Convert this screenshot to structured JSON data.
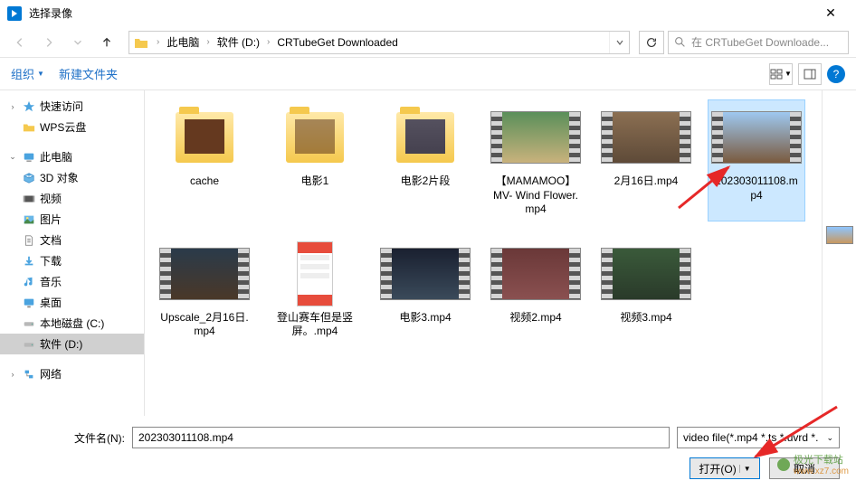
{
  "window": {
    "title": "选择录像"
  },
  "breadcrumb": {
    "items": [
      "此电脑",
      "软件 (D:)",
      "CRTubeGet Downloaded"
    ]
  },
  "search": {
    "placeholder": "在 CRTubeGet Downloade..."
  },
  "toolbar": {
    "organize": "组织",
    "new_folder": "新建文件夹"
  },
  "sidebar": {
    "quick_access": "快速访问",
    "wps_cloud": "WPS云盘",
    "this_pc": "此电脑",
    "objects3d": "3D 对象",
    "videos": "视频",
    "pictures": "图片",
    "documents": "文档",
    "downloads": "下载",
    "music": "音乐",
    "desktop": "桌面",
    "local_c": "本地磁盘 (C:)",
    "drive_d": "软件 (D:)",
    "network": "网络"
  },
  "files": {
    "r1": [
      {
        "name": "cache",
        "type": "folder"
      },
      {
        "name": "电影1",
        "type": "folder"
      },
      {
        "name": "电影2片段",
        "type": "folder"
      },
      {
        "name": "【MAMAMOO】MV- Wind Flower.mp4",
        "type": "video"
      },
      {
        "name": "2月16日.mp4",
        "type": "video"
      },
      {
        "name": "202303011108.mp4",
        "type": "video",
        "selected": true
      }
    ],
    "r2": [
      {
        "name": "Upscale_2月16日.mp4",
        "type": "video"
      },
      {
        "name": "登山赛车但是竖屏。.mp4",
        "type": "phone"
      },
      {
        "name": "电影3.mp4",
        "type": "video"
      },
      {
        "name": "视频2.mp4",
        "type": "video"
      },
      {
        "name": "视频3.mp4",
        "type": "video"
      }
    ]
  },
  "footer": {
    "filename_label": "文件名(N):",
    "filename_value": "202303011108.mp4",
    "filter": "video file(*.mp4 *.ts *.uvrd *.",
    "open": "打开(O)",
    "cancel": "取消"
  },
  "watermark": {
    "text": "极光下载站",
    "url": "www.xz7.com"
  },
  "video_colors": {
    "mamamoo": "linear-gradient(#5a8f5a, #c9b27c)",
    "feb16": "linear-gradient(#8b6f52, #5e4a38)",
    "selected": "linear-gradient(#9ec8f0, #7a5a3e)",
    "upscale": "linear-gradient(#2a3a4a, #4a3828)",
    "movie3": "linear-gradient(#1a2030, #3a4a5a)",
    "video2": "linear-gradient(#6a3838, #8a5050)",
    "video3": "linear-gradient(#3a5a3a, #2a3a2a)",
    "folder_m1": "#2a5030",
    "folder_m2": "#4a6a8a"
  }
}
